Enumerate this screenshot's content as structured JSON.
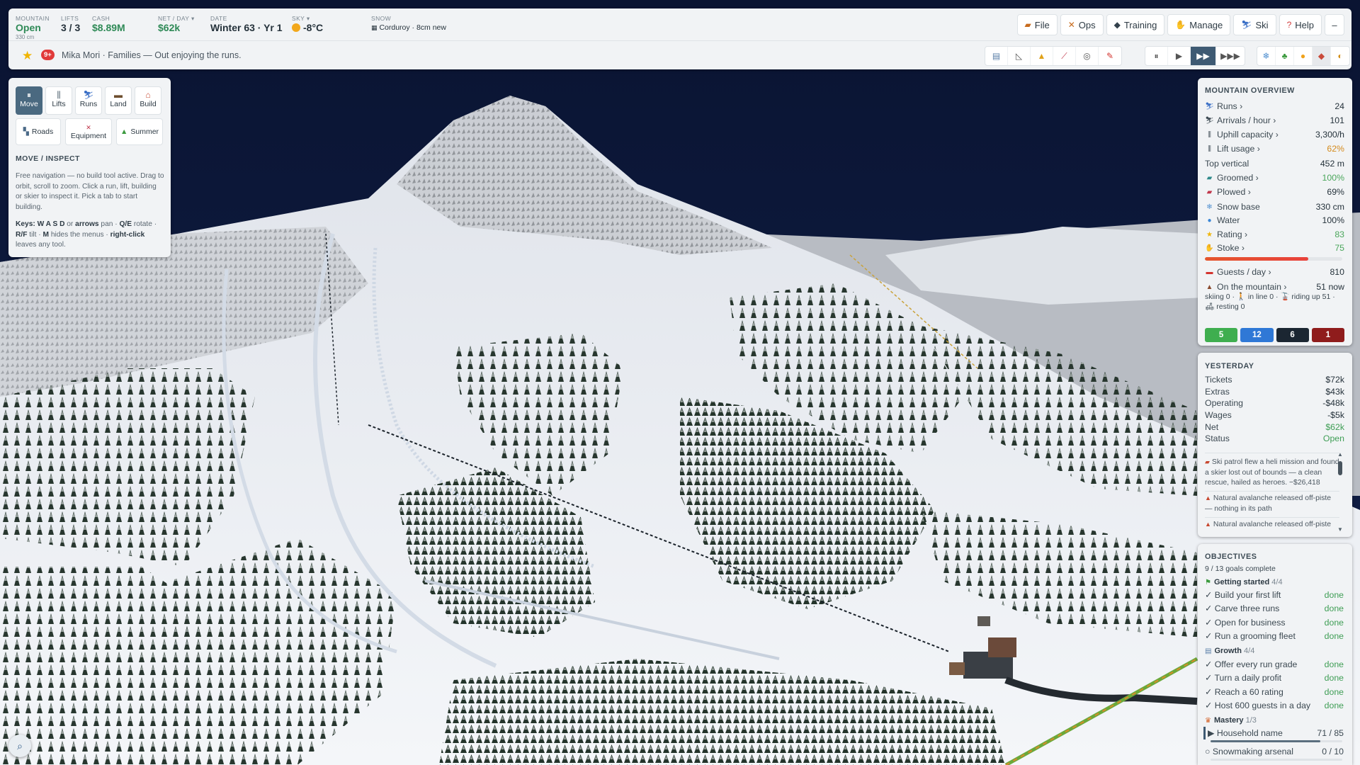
{
  "topbar": {
    "mountain": {
      "label": "MOUNTAIN",
      "value": "Open",
      "sub": "330 cm"
    },
    "lifts": {
      "label": "LIFTS",
      "value": "3 / 3"
    },
    "cash": {
      "label": "CASH",
      "value": "$8.89M"
    },
    "net": {
      "label": "NET / DAY ▾",
      "value": "$62k"
    },
    "date": {
      "label": "DATE",
      "value": "Winter 63 · Yr 1"
    },
    "sky": {
      "label": "SKY ▾",
      "value": "-8°C"
    },
    "snow": {
      "label": "SNOW",
      "value": "Corduroy · 8cm new"
    },
    "menu": [
      "File",
      "Ops",
      "Training",
      "Manage",
      "Ski",
      "Help"
    ],
    "menu_icons": [
      "folder-icon",
      "tools-icon",
      "cap-icon",
      "hand-icon",
      "skier-icon",
      "question-icon"
    ],
    "minimize": "–",
    "alert_count": "9+",
    "ticker": "Mika Mori · Families — Out enjoying the runs.",
    "speed": {
      "pause": "⏸",
      "play": "▶",
      "fast": "▶▶",
      "fastest": "▶▶▶",
      "active": "fast"
    }
  },
  "leftpanel": {
    "tabs": [
      "Move",
      "Lifts",
      "Runs",
      "Land",
      "Build"
    ],
    "tabs2": [
      "Roads",
      "Equipment",
      "Summer"
    ],
    "title": "MOVE / INSPECT",
    "text": "Free navigation — no build tool active. Drag to orbit, scroll to zoom. Click a run, lift, building or skier to inspect it. Pick a tab to start building.",
    "keys": {
      "k1": "Keys: W A S D",
      "t1": " or ",
      "k2": "arrows",
      "t2": " pan · ",
      "k3": "Q/E",
      "t3": " rotate · ",
      "k4": "R/F",
      "t4": " tilt · ",
      "k5": "M",
      "t5": " hides the menus · ",
      "k6": "right-click",
      "t6": " leaves any tool."
    }
  },
  "overview": {
    "title": "MOUNTAIN OVERVIEW",
    "rows": [
      {
        "label": "Runs ›",
        "value": "24",
        "icon": "skier-icon",
        "tone": ""
      },
      {
        "label": "Arrivals / hour ›",
        "value": "101",
        "icon": "arrivals-icon",
        "tone": ""
      },
      {
        "label": "Uphill capacity ›",
        "value": "3,300/h",
        "icon": "lift-icon",
        "tone": ""
      },
      {
        "label": "Lift usage ›",
        "value": "62%",
        "icon": "lift-icon",
        "tone": "orange"
      },
      {
        "label": "Top vertical",
        "value": "452 m",
        "icon": "",
        "tone": ""
      },
      {
        "label": "Groomed ›",
        "value": "100%",
        "icon": "groomer-icon",
        "tone": "green"
      },
      {
        "label": "Plowed ›",
        "value": "69%",
        "icon": "plow-icon",
        "tone": ""
      },
      {
        "label": "Snow base",
        "value": "330 cm",
        "icon": "snowflake-icon",
        "tone": ""
      },
      {
        "label": "Water",
        "value": "100%",
        "icon": "water-icon",
        "tone": ""
      },
      {
        "label": "Rating ›",
        "value": "83",
        "icon": "star-icon",
        "tone": "green"
      },
      {
        "label": "Stoke ›",
        "value": "75",
        "icon": "hand-icon",
        "tone": "green"
      }
    ],
    "stoke_level": 0.75,
    "guests": {
      "label": "Guests / day ›",
      "value": "810"
    },
    "on_mountain": {
      "label": "On the mountain ›",
      "value": "51 now"
    },
    "breakdown": "skiing 0 · 🚶 in line 0 · 🚡 riding up 51 · 🛋 resting 0",
    "grades": [
      {
        "count": "5",
        "color": "#3fae4f"
      },
      {
        "count": "12",
        "color": "#2f78d6"
      },
      {
        "count": "6",
        "color": "#1b2632"
      },
      {
        "count": "1",
        "color": "#8f1c1c"
      }
    ]
  },
  "yesterday": {
    "title": "YESTERDAY",
    "rows": [
      {
        "label": "Tickets",
        "value": "$72k",
        "tone": ""
      },
      {
        "label": "Extras",
        "value": "$43k",
        "tone": ""
      },
      {
        "label": "Operating",
        "value": "-$48k",
        "tone": ""
      },
      {
        "label": "Wages",
        "value": "-$5k",
        "tone": ""
      },
      {
        "label": "Net",
        "value": "$62k",
        "tone": "green"
      },
      {
        "label": "Status",
        "value": "Open",
        "tone": "green"
      }
    ],
    "log": [
      "Ski patrol flew a heli mission and found a skier lost out of bounds — a clean rescue, hailed as heroes. −$26,418",
      "Natural avalanche released off-piste — nothing in its path",
      "Natural avalanche released off-piste — nothing in its path"
    ]
  },
  "objectives": {
    "title": "OBJECTIVES",
    "summary": "9 / 13 goals complete",
    "sections": [
      {
        "name": "Getting started",
        "count": "4/4",
        "items": [
          {
            "label": "✓ Build your first lift",
            "status": "done"
          },
          {
            "label": "✓ Carve three runs",
            "status": "done"
          },
          {
            "label": "✓ Open for business",
            "status": "done"
          },
          {
            "label": "✓ Run a grooming fleet",
            "status": "done"
          }
        ]
      },
      {
        "name": "Growth",
        "count": "4/4",
        "items": [
          {
            "label": "✓ Offer every run grade",
            "status": "done"
          },
          {
            "label": "✓ Turn a daily profit",
            "status": "done"
          },
          {
            "label": "✓ Reach a 60 rating",
            "status": "done"
          },
          {
            "label": "✓ Host 600 guests in a day",
            "status": "done"
          }
        ]
      },
      {
        "name": "Mastery",
        "count": "1/3",
        "items": [
          {
            "label": "▶ Household name",
            "status": "71 / 85",
            "progress": 0.835
          },
          {
            "label": "○ Snowmaking arsenal",
            "status": "0 / 10",
            "progress": 0
          }
        ]
      }
    ]
  }
}
